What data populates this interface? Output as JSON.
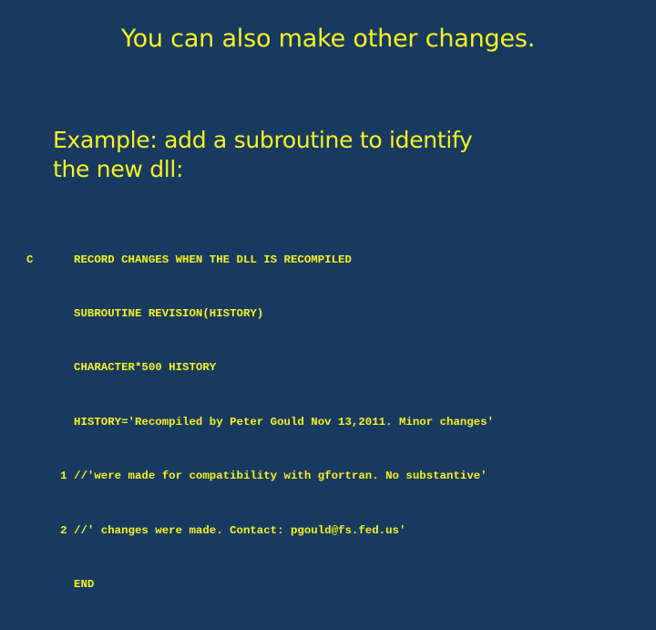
{
  "theme": {
    "background_color": "#193a60",
    "text_color": "#f4f222"
  },
  "slide": {
    "title": "You can also make other changes.",
    "subtitle_lines": [
      "Example: add a subroutine to identify",
      "the new dll:"
    ],
    "code_lines": [
      "C      RECORD CHANGES WHEN THE DLL IS RECOMPILED",
      "       SUBROUTINE REVISION(HISTORY)",
      "       CHARACTER*500 HISTORY",
      "       HISTORY='Recompiled by Peter Gould Nov 13,2011. Minor changes'",
      "     1 //'were made for compatibility with gfortran. No substantive'",
      "     2 //' changes were made. Contact: pgould@fs.fed.us'",
      "       END"
    ]
  }
}
